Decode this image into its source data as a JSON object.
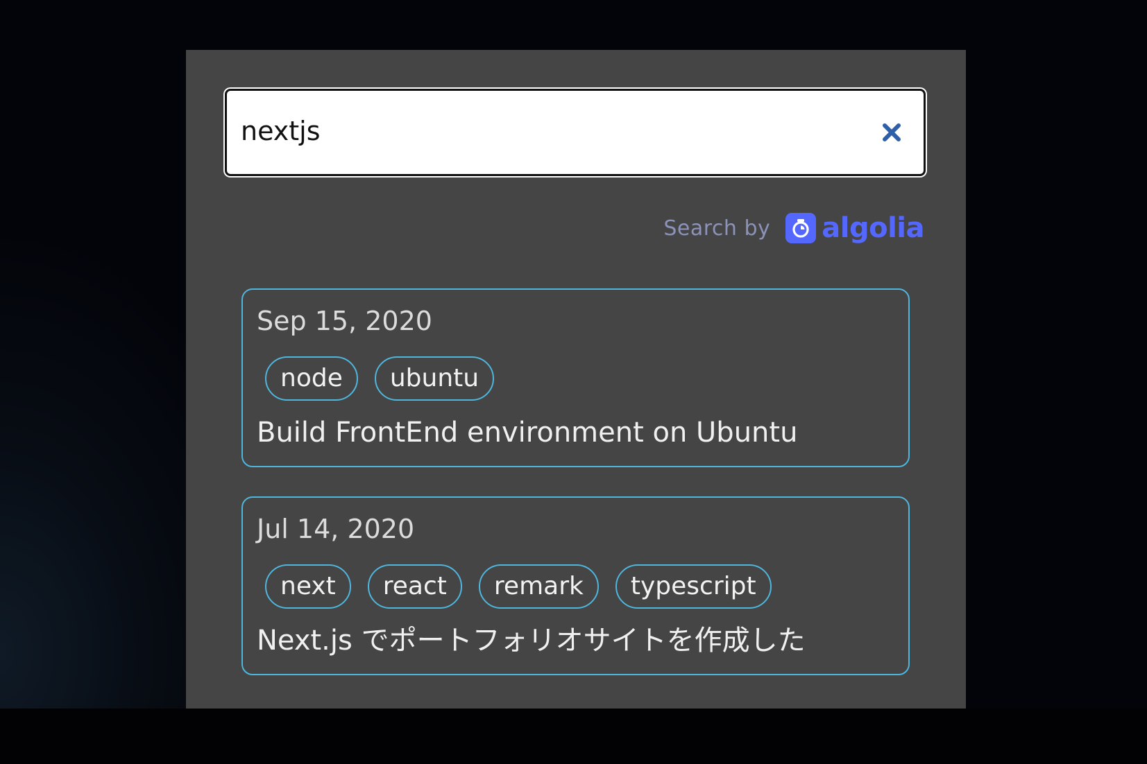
{
  "search": {
    "value": "nextjs",
    "clear_icon": "close-icon"
  },
  "powered_by": {
    "label": "Search by",
    "brand": "algolia",
    "brand_icon": "algolia-logo-icon",
    "brand_color": "#5468ff"
  },
  "hits": [
    {
      "date": "Sep 15, 2020",
      "tags": [
        "node",
        "ubuntu"
      ],
      "title": "Build FrontEnd environment on Ubuntu"
    },
    {
      "date": "Jul 14, 2020",
      "tags": [
        "next",
        "react",
        "remark",
        "typescript"
      ],
      "title": "Next.js でポートフォリオサイトを作成した"
    }
  ],
  "colors": {
    "panel": "#454545",
    "accent_border": "#4fb6dd",
    "clear_icon": "#2f5fa8"
  }
}
